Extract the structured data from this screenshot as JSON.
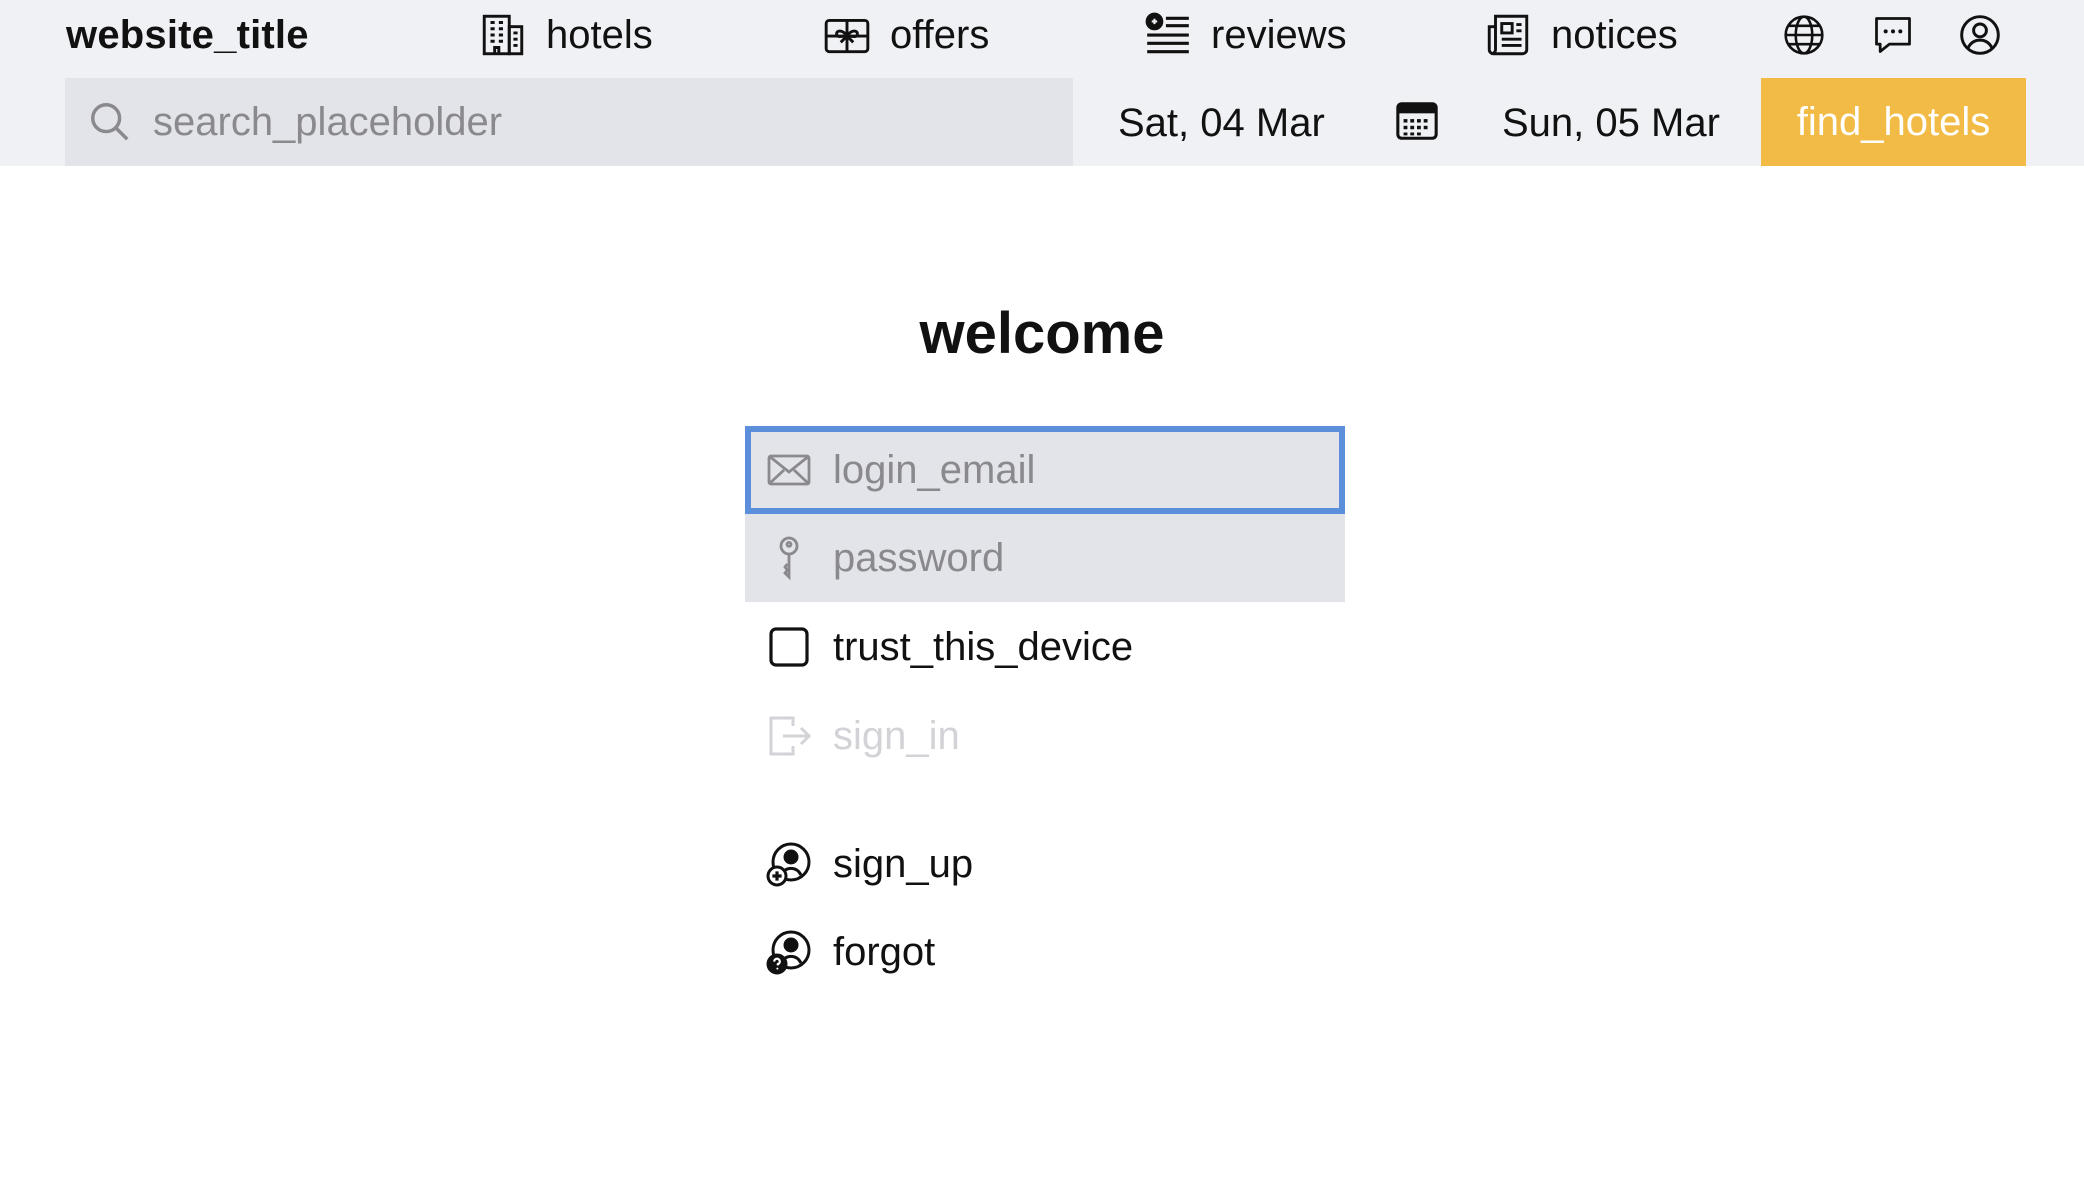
{
  "header": {
    "site_title": "website_title",
    "nav": [
      {
        "label": "hotels",
        "icon": "building-icon"
      },
      {
        "label": "offers",
        "icon": "gift-icon"
      },
      {
        "label": "reviews",
        "icon": "reviews-list-icon"
      },
      {
        "label": "notices",
        "icon": "newspaper-icon"
      }
    ],
    "icons": [
      "globe-icon",
      "chat-icon",
      "account-icon"
    ],
    "search": {
      "placeholder": "search_placeholder",
      "value": ""
    },
    "checkin_date": "Sat, 04 Mar",
    "checkout_date": "Sun, 05 Mar",
    "find_label": "find_hotels"
  },
  "login": {
    "heading": "welcome",
    "email": {
      "placeholder": "login_email",
      "value": ""
    },
    "password": {
      "placeholder": "password",
      "value": ""
    },
    "trust_label": "trust_this_device",
    "trust_checked": false,
    "sign_in_label": "sign_in",
    "sign_in_enabled": false,
    "sign_up_label": "sign_up",
    "forgot_label": "forgot"
  },
  "colors": {
    "header_bg": "#f0f1f5",
    "field_bg": "#e3e4e9",
    "accent": "#f2bb46",
    "focus_border": "#5b8fdc",
    "disabled_text": "#d3d3d7"
  }
}
